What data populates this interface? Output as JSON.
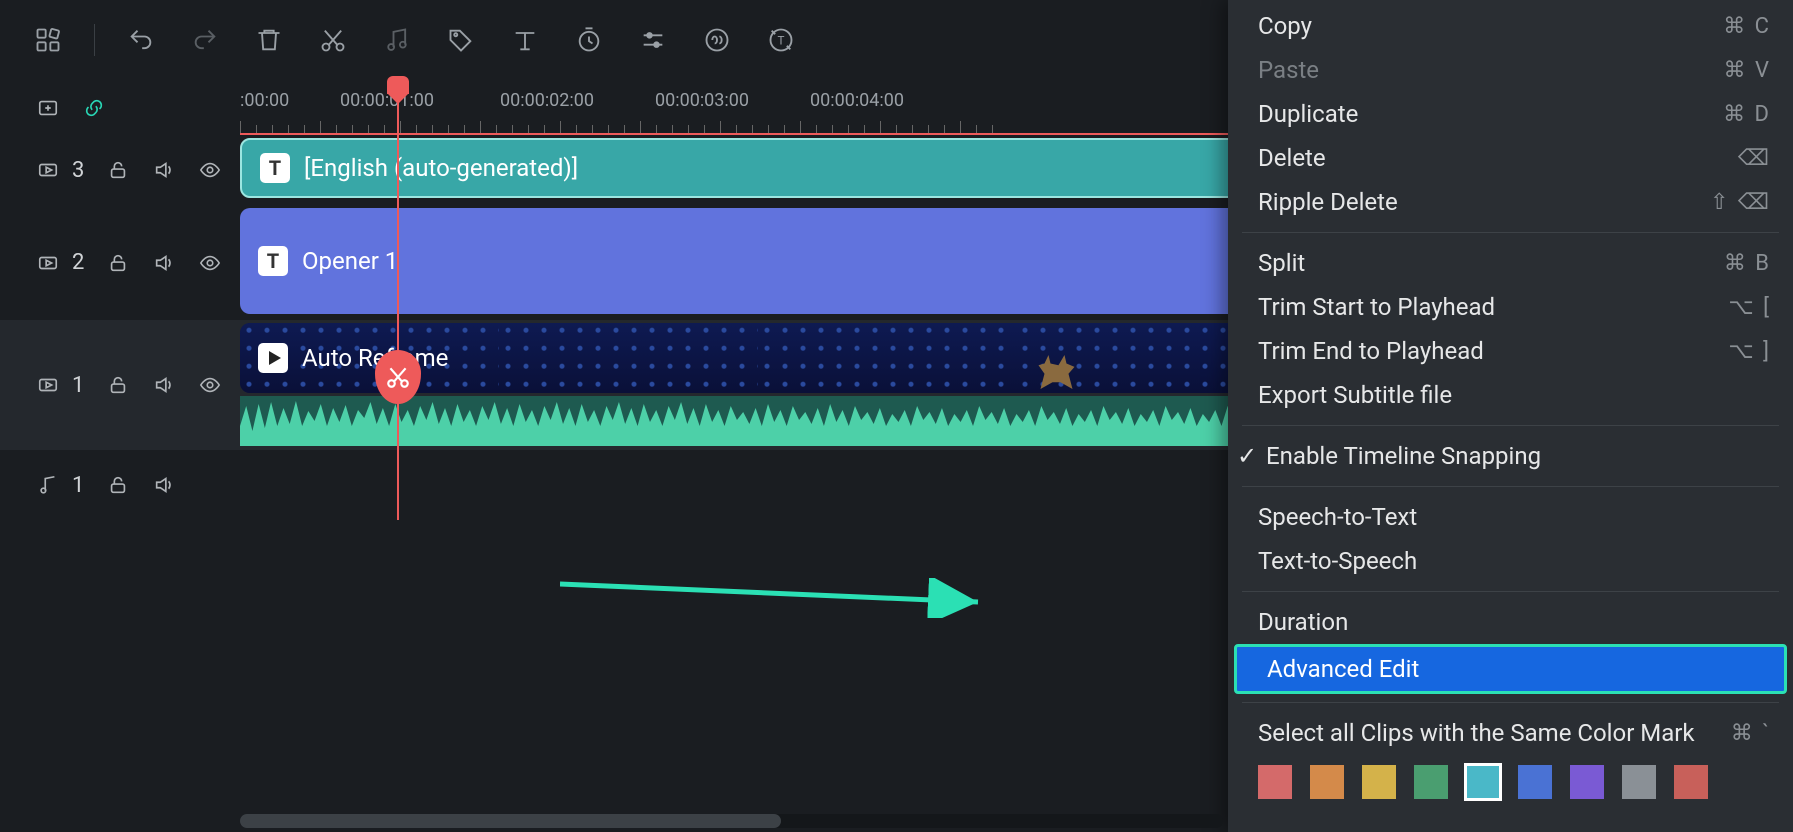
{
  "toolbar": {
    "icons": [
      "apps",
      "undo",
      "redo",
      "delete",
      "cut",
      "music-note",
      "tag",
      "text",
      "timer",
      "sliders",
      "audio-fx",
      "replace-text"
    ]
  },
  "ruler": {
    "timestamps": [
      ":00:00",
      "00:00:01:00",
      "00:00:02:00",
      "00:00:03:00",
      "00:00:04:00"
    ]
  },
  "tracks": {
    "t3": {
      "num": "3"
    },
    "t2": {
      "num": "2"
    },
    "t1": {
      "num": "1"
    },
    "audio": {
      "num": "1"
    }
  },
  "clips": {
    "subtitle_label": "[English (auto-generated)]",
    "opener_label": "Opener 1",
    "video_label": "Auto Reframe"
  },
  "menu": {
    "copy": {
      "label": "Copy",
      "sc": "⌘ C"
    },
    "paste": {
      "label": "Paste",
      "sc": "⌘ V"
    },
    "duplicate": {
      "label": "Duplicate",
      "sc": "⌘ D"
    },
    "delete": {
      "label": "Delete",
      "sc": "⌫"
    },
    "ripple": {
      "label": "Ripple Delete",
      "sc": "⇧ ⌫"
    },
    "split": {
      "label": "Split",
      "sc": "⌘ B"
    },
    "trimstart": {
      "label": "Trim Start to Playhead",
      "sc": "⌥  ["
    },
    "trimend": {
      "label": "Trim End to Playhead",
      "sc": "⌥  ]"
    },
    "exportsub": {
      "label": "Export Subtitle file",
      "sc": ""
    },
    "snapping": {
      "label": "Enable Timeline Snapping"
    },
    "stt": {
      "label": "Speech-to-Text"
    },
    "tts": {
      "label": "Text-to-Speech"
    },
    "duration": {
      "label": "Duration"
    },
    "advanced": {
      "label": "Advanced Edit"
    },
    "selectcolor": {
      "label": "Select all Clips with the Same Color Mark",
      "sc": "⌘  `"
    }
  },
  "colors": [
    "#d46a6a",
    "#d48a4a",
    "#d4b24a",
    "#4a9e70",
    "#4ab8c8",
    "#4a72d4",
    "#7a5ad4",
    "#8a9096",
    "#c8605a"
  ]
}
